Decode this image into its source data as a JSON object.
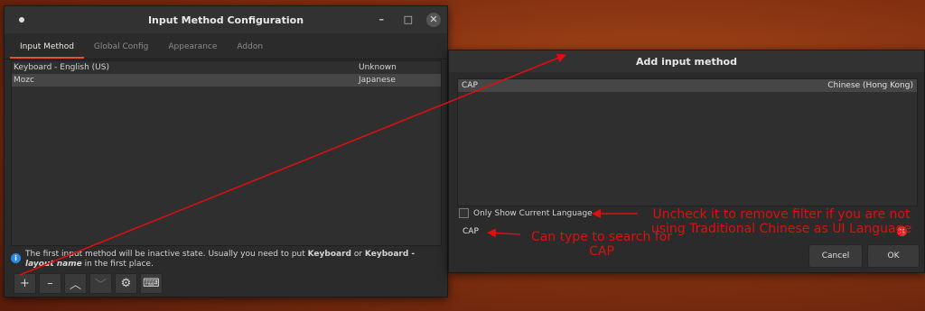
{
  "config_window": {
    "title": "Input Method Configuration",
    "tabs": [
      "Input Method",
      "Global Config",
      "Appearance",
      "Addon"
    ],
    "controls": {
      "minimize": "–",
      "maximize": "□",
      "close": "✕"
    },
    "rows": [
      {
        "name": "Keyboard - English (US)",
        "language": "Unknown"
      },
      {
        "name": "Mozc",
        "language": "Japanese"
      }
    ],
    "info": {
      "icon": "i",
      "part1": "The first input method will be inactive state. Usually you need to put ",
      "bold1": "Keyboard",
      "part2": " or ",
      "bold2": "Keyboard - ",
      "bold_italic": "layout name",
      "part3": " in the first place."
    },
    "toolbar": {
      "add": "+",
      "remove": "–",
      "up": "︿",
      "down": "﹀",
      "configure": "⚙",
      "keyboard": "⌨"
    }
  },
  "add_dialog": {
    "title": "Add input method",
    "result": {
      "name": "CAP",
      "language": "Chinese (Hong Kong)"
    },
    "filter_label": "Only Show Current Language",
    "filter_checked": false,
    "search_value": "CAP",
    "clear_icon": "✕",
    "cancel_label": "Cancel",
    "ok_label": "OK"
  },
  "annotations": {
    "uncheck": "Uncheck it to remove filter if you are not using Traditional Chinese as UI Language",
    "search": "Can type to search for CAP",
    "color": "#e30d0d"
  }
}
